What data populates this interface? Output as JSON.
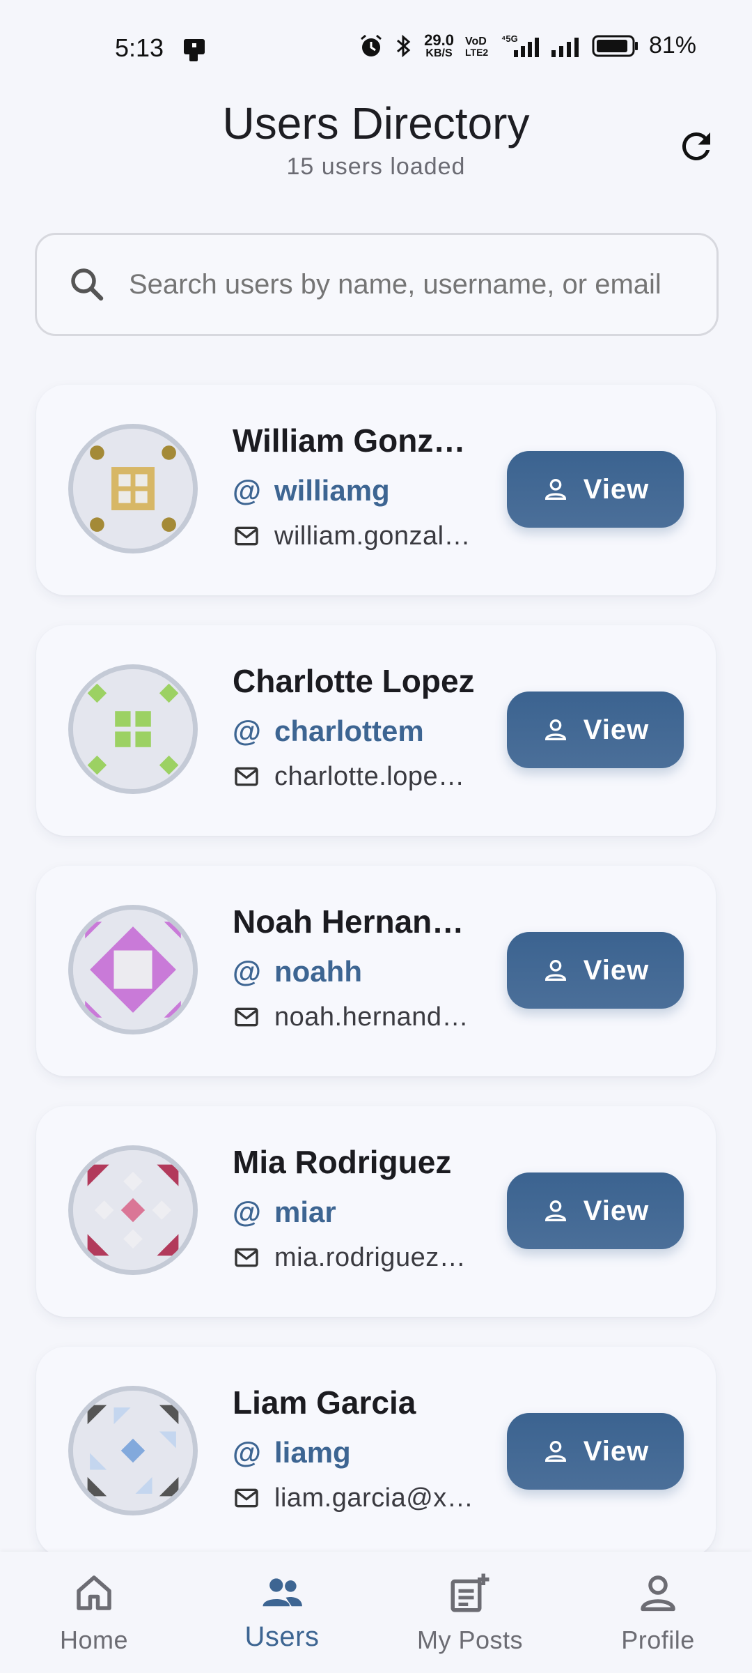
{
  "status_bar": {
    "time": "5:13",
    "net_speed_top": "29.0",
    "net_speed_bottom": "KB/S",
    "battery": "81%"
  },
  "header": {
    "title": "Users Directory",
    "subtitle": "15 users loaded"
  },
  "search": {
    "placeholder": "Search users by name, username, or email"
  },
  "users": [
    {
      "name": "William Gonzalez",
      "handle": "williamg",
      "email": "william.gonzalez@example.com",
      "button": "View"
    },
    {
      "name": "Charlotte Lopez",
      "handle": "charlottem",
      "email": "charlotte.lopez@example.com",
      "button": "View"
    },
    {
      "name": "Noah Hernandez",
      "handle": "noahh",
      "email": "noah.hernandez@example.com",
      "button": "View"
    },
    {
      "name": "Mia Rodriguez",
      "handle": "miar",
      "email": "mia.rodriguez@example.com",
      "button": "View"
    },
    {
      "name": "Liam Garcia",
      "handle": "liamg",
      "email": "liam.garcia@x.com",
      "button": "View"
    }
  ],
  "nav": {
    "home": "Home",
    "users": "Users",
    "my_posts": "My Posts",
    "profile": "Profile"
  },
  "colors": {
    "accent": "#3d6592",
    "background": "#f5f6fb",
    "card": "#f7f8fd"
  }
}
